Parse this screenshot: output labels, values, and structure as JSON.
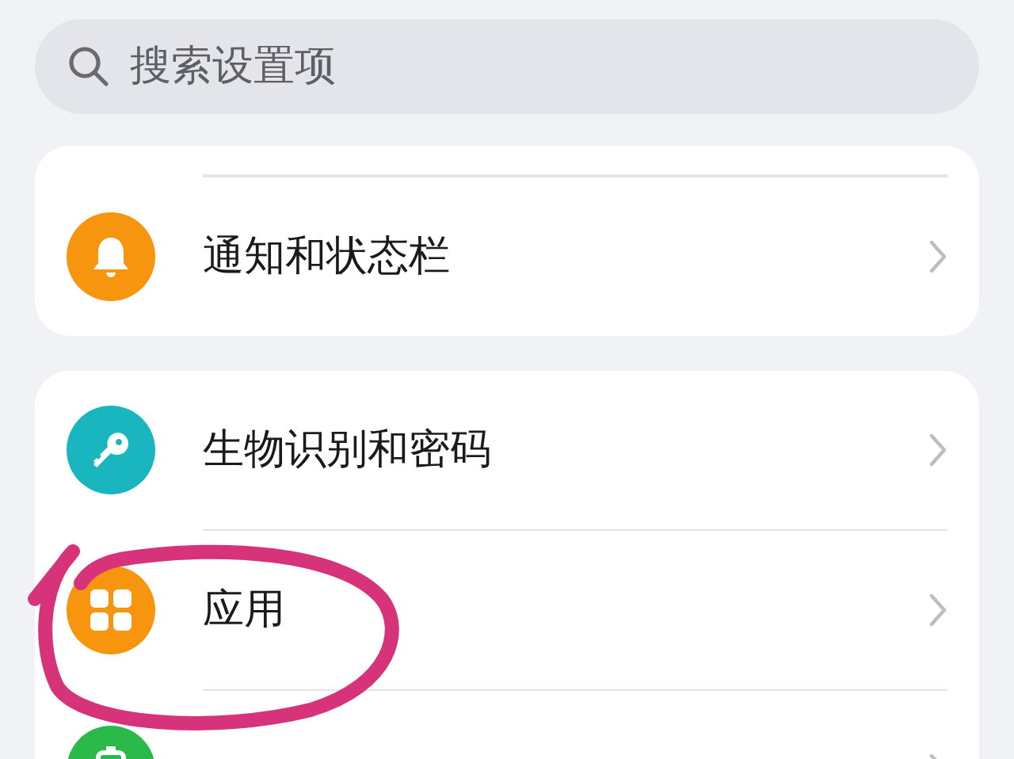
{
  "search": {
    "placeholder": "搜索设置项"
  },
  "groups": [
    {
      "items": [
        {
          "label": "通知和状态栏",
          "kind": "bell",
          "color": "#f7950f"
        }
      ]
    },
    {
      "items": [
        {
          "label": "生物识别和密码",
          "kind": "key",
          "color": "#1ab6c0"
        },
        {
          "label": "应用",
          "kind": "grid",
          "color": "#f7950f"
        },
        {
          "kind": "battery",
          "color": "#2bb94a"
        }
      ]
    }
  ],
  "annotation": {
    "kind": "circle",
    "color": "#d6337a"
  }
}
